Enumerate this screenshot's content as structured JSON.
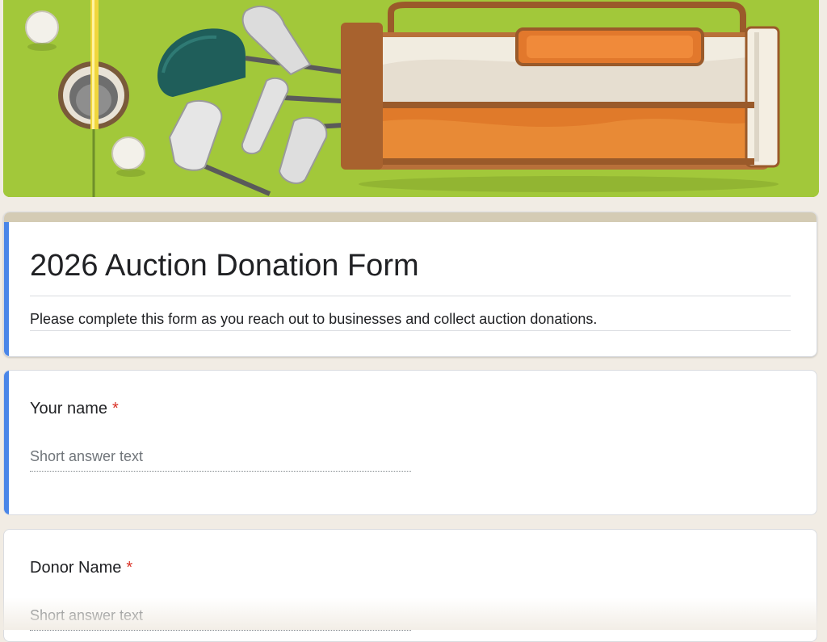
{
  "banner": {
    "image_description_icon": "golf-bag-illustration-icon"
  },
  "form": {
    "title": "2026 Auction Donation Form",
    "description": "Please complete this form as you reach out to businesses and collect auction donations."
  },
  "questions": [
    {
      "label": "Your name",
      "required_mark": "*",
      "placeholder": "Short answer text"
    },
    {
      "label": "Donor Name",
      "required_mark": "*",
      "placeholder": "Short answer text"
    }
  ],
  "colors": {
    "accent": "#4a86e8",
    "header_bar": "#d4cbb4",
    "background": "#f1ece4",
    "required": "#d93025"
  }
}
